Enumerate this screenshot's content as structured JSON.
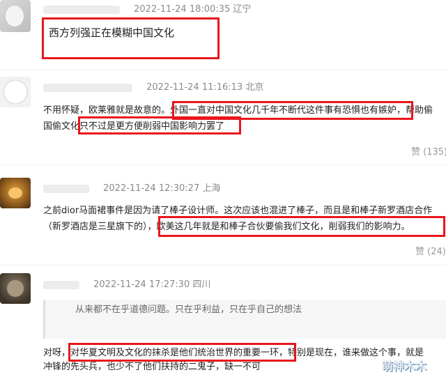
{
  "comments": [
    {
      "time": "2022-11-24 18:00:35",
      "location": "辽宁",
      "text": "西方列强正在模糊中国文化"
    },
    {
      "time": "2022-11-24 11:16:13",
      "location": "北京",
      "line1_a": "不用怀疑，欧莱雅就是故意的。",
      "line1_b": "外国一直对中国文化几千年不断代这件事有恐惧也有嫉妒",
      "line1_c": "，帮助偷",
      "line2_a": "国偷文化",
      "line2_b": "只不过是更方便削弱中国影响力罢了",
      "likes": "赞 (135)"
    },
    {
      "time": "2022-11-24 12:30:27",
      "location": "上海",
      "line1": "之前dior马面裙事件是因为请了棒子设计师。这次应该也混进了棒子，而且是和棒子新罗酒店合作",
      "line2_a": "（新罗酒店是三星旗下的），",
      "line2_b": "欧美这几年就是和棒子合伙要偷我们文化，削弱我们的影响力。",
      "likes": "赞 (24)"
    },
    {
      "time": "2022-11-24 17:27:30",
      "location": "四川",
      "quote": "从来都不在乎道德问题。只在乎利益，只在乎自己的想法",
      "line1_a": "对呀，",
      "line1_b": "对华夏文明及文化的抹杀是他们统治世界的重要一环，",
      "line1_c": "特别是现在，谁来做这个事，",
      "line1_d": "就是",
      "line2": "冲锋的先头兵，也少不了他们扶持的二鬼子，缺一不可"
    }
  ],
  "watermark": "萌神木木",
  "colors": {
    "highlight_box": "#e8161c",
    "meta_text": "#8a8a8a"
  }
}
